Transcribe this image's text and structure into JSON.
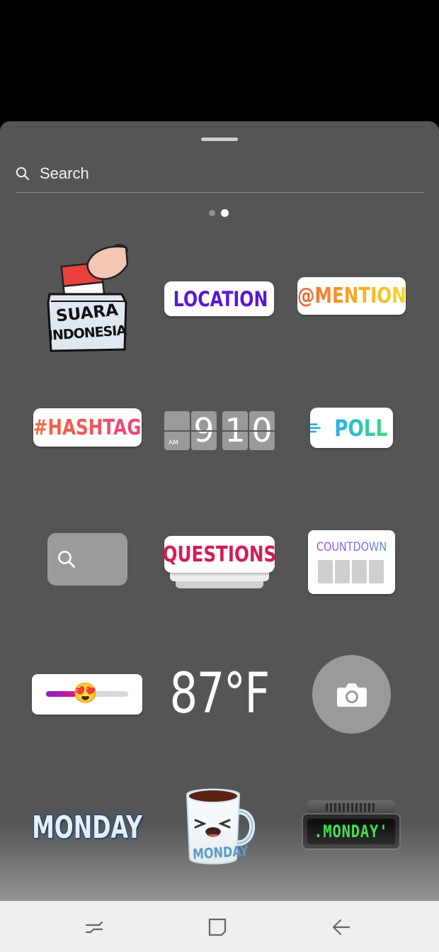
{
  "search": {
    "label": "Search"
  },
  "pager": {
    "pages": 2,
    "active": 2
  },
  "stickers": {
    "suara": {
      "line1": "SUARA",
      "line2": "INDONESIA"
    },
    "location": {
      "label": "LOCATION",
      "color": "#6a1ad6"
    },
    "mention": {
      "label": "@MENTION"
    },
    "hashtag": {
      "label": "#HASHTAG"
    },
    "clock": {
      "h": "9",
      "m1": "1",
      "m2": "0",
      "ampm": "AM"
    },
    "poll": {
      "label": "POLL"
    },
    "questions": {
      "label": "QUESTIONS",
      "color": "#d21c57"
    },
    "countdown": {
      "label": "COUNTDOWN"
    },
    "slider": {
      "emoji": "😍",
      "level": 0.32
    },
    "temperature": {
      "label": "87°F"
    },
    "monday_text": {
      "label": "MONDAY"
    },
    "monday_mug": {
      "label": "MONDAY"
    },
    "monday_clock": {
      "label": ".MONDAY'"
    }
  },
  "icons": {
    "search": "search-icon",
    "camera": "camera-icon",
    "location": "location-pin-icon",
    "recent": "recent-apps-icon",
    "home": "home-icon",
    "back": "back-icon"
  }
}
